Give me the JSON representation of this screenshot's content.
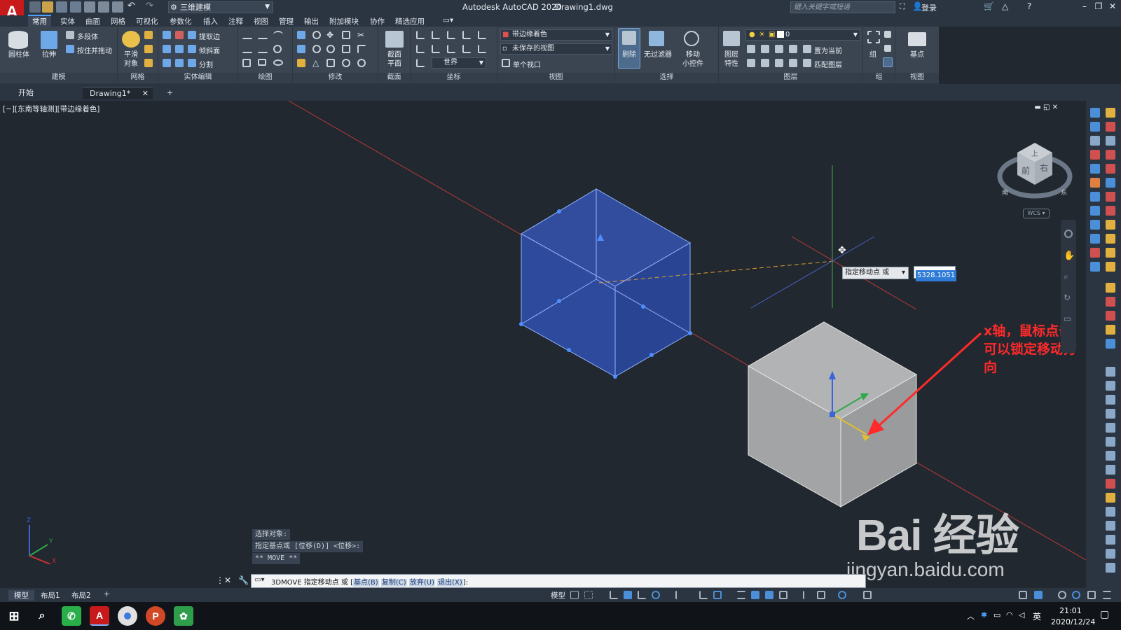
{
  "app": {
    "title": "Autodesk AutoCAD 2020",
    "file": "Drawing1.dwg",
    "workspace": "三维建模",
    "search_placeholder": "键入关键字或短语",
    "login": "登录"
  },
  "menu_tabs": [
    "常用",
    "实体",
    "曲面",
    "网格",
    "可视化",
    "参数化",
    "插入",
    "注释",
    "视图",
    "管理",
    "输出",
    "附加模块",
    "协作",
    "精选应用"
  ],
  "ribbon": {
    "modeling": {
      "title": "建模",
      "box": "圆柱体",
      "extrude": "拉伸",
      "polysolid": "多段体",
      "presspull": "按住并拖动"
    },
    "mesh": {
      "title": "网格",
      "smooth_line1": "平滑",
      "smooth_line2": "对象"
    },
    "solid_edit": {
      "title": "实体编辑",
      "extract": "提取边",
      "taper": "倾斜面",
      "separate": "分割"
    },
    "draw": {
      "title": "绘图"
    },
    "modify": {
      "title": "修改"
    },
    "section": {
      "title": "截面",
      "plane_line1": "截面",
      "plane_line2": "平面"
    },
    "coordinates": {
      "title": "坐标",
      "world": "世界"
    },
    "view": {
      "title": "视图",
      "visual_style": "带边缘着色",
      "named_view": "未保存的视图",
      "viewport": "单个视口"
    },
    "selection": {
      "title": "选择",
      "cull": "剔除",
      "nofilter": "无过滤器",
      "gizmo_line1": "移动",
      "gizmo_line2": "小控件"
    },
    "layers": {
      "title": "图层",
      "props_line1": "图层",
      "props_line2": "特性",
      "layer_value": "0",
      "set_current": "置为当前",
      "match": "匹配图层"
    },
    "groups": {
      "title": "组",
      "group": "组"
    },
    "view2": {
      "title": "视图",
      "base": "基点"
    }
  },
  "doc_tabs": {
    "start": "开始",
    "drawing": "Drawing1*",
    "add": "+"
  },
  "viewport": {
    "label": "[−][东南等轴测][带边缘着色]",
    "controls": "▬ ◱ ✕",
    "prompt_label": "指定移动点 或",
    "prompt_value": "5328.1051",
    "wcs": "WCS"
  },
  "viewcube": {
    "top": "上",
    "front": "前",
    "right": "右",
    "south": "南",
    "east": "东"
  },
  "annotation": {
    "line1": "x轴，鼠标点击",
    "line2": "可以锁定移动方向"
  },
  "command_history": [
    "选择对象:",
    "指定基点或 [位移(D)] <位移>:",
    "** MOVE **"
  ],
  "command_line": {
    "prefix": "3DMOVE 指定移动点 或 [",
    "base": "基点(B)",
    "copy": "复制(C)",
    "undo": "放弃(U)",
    "exit": "退出(X)",
    "suffix": "]:"
  },
  "layout_tabs": [
    "模型",
    "布局1",
    "布局2",
    "+"
  ],
  "statusbar": {
    "model": "模型"
  },
  "watermark": {
    "main": "Bai 经验",
    "sub": "jingyan.baidu.com"
  },
  "taskbar": {
    "time": "21:01",
    "date": "2020/12/24",
    "ime": "英"
  },
  "ucs": {
    "x": "X",
    "y": "Y",
    "z": "Z"
  },
  "colors": {
    "selected_cube": "#3a5bbf",
    "gray_cube": "#a8a9aa",
    "axis_x": "#cc3333",
    "axis_y": "#33aa33",
    "annotation": "#ff2a2a"
  }
}
